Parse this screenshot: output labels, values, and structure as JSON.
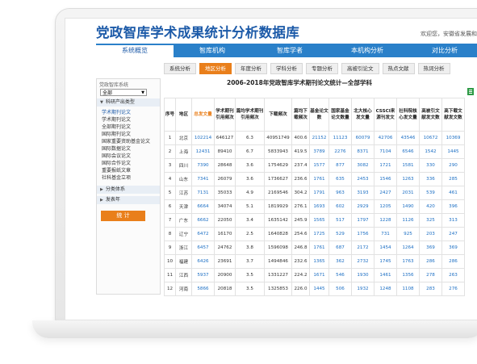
{
  "app": {
    "title": "党政智库学术成果统计分析数据库",
    "welcome": "欢迎您，安徽省发展和改革"
  },
  "nav": {
    "items": [
      {
        "label": "系统概览",
        "active": true
      },
      {
        "label": "智库机构",
        "active": false
      },
      {
        "label": "智库学者",
        "active": false
      },
      {
        "label": "本机构分析",
        "active": false
      },
      {
        "label": "对比分析",
        "active": false
      }
    ]
  },
  "subtabs": [
    {
      "label": "系统分析",
      "active": false
    },
    {
      "label": "地区分析",
      "active": true
    },
    {
      "label": "年度分析",
      "active": false
    },
    {
      "label": "学科分析",
      "active": false
    },
    {
      "label": "专题分析",
      "active": false
    },
    {
      "label": "高被引论文",
      "active": false
    },
    {
      "label": "热点文献",
      "active": false
    },
    {
      "label": "热词分析",
      "active": false
    }
  ],
  "sidebar": {
    "heading": "党政智库系统",
    "select_value": "全部",
    "group1": "科研产出类型",
    "items": [
      "学术期刊论文",
      "学术期刊论文",
      "全部期刊论文",
      "国际期刊论文",
      "国家重要资助基金论文",
      "国际数据论文",
      "国际会议论文",
      "国际合作论文",
      "重要报纸文章",
      "社科基金立项"
    ],
    "group2": "分类体系",
    "group3": "发表年",
    "stat_button": "统 计"
  },
  "table": {
    "title": "2006-2018年党政智库学术期刊论文统计—全部学科",
    "headers": [
      "序号",
      "地区",
      "总发文量",
      "学术期刊引用频次",
      "篇均学术期刊引用频次",
      "下载频次",
      "篇均下载频次",
      "基金论文数",
      "国家基金论文数量",
      "北大核心发文量",
      "CSSCI来源刊发文",
      "社科院核心发文量",
      "高被引文献发文数",
      "高下载文献发文数"
    ],
    "rows": [
      [
        "1",
        "北京",
        "102214",
        "646127",
        "6.3",
        "40951749",
        "400.6",
        "21152",
        "11123",
        "60079",
        "42706",
        "43546",
        "10672",
        "10369"
      ],
      [
        "2",
        "上海",
        "12431",
        "89410",
        "6.7",
        "5833943",
        "419.5",
        "3789",
        "2276",
        "8371",
        "7104",
        "6546",
        "1542",
        "1445"
      ],
      [
        "3",
        "四川",
        "7390",
        "28648",
        "3.6",
        "1754629",
        "237.4",
        "1577",
        "877",
        "3082",
        "1721",
        "1581",
        "330",
        "290"
      ],
      [
        "4",
        "山东",
        "7341",
        "26079",
        "3.6",
        "1736627",
        "236.6",
        "1761",
        "635",
        "2453",
        "1546",
        "1263",
        "336",
        "285"
      ],
      [
        "5",
        "江苏",
        "7131",
        "35033",
        "4.9",
        "2169546",
        "304.2",
        "1791",
        "963",
        "3193",
        "2427",
        "2031",
        "539",
        "461"
      ],
      [
        "6",
        "天津",
        "6664",
        "34074",
        "5.1",
        "1819929",
        "276.1",
        "1693",
        "602",
        "2929",
        "1205",
        "1490",
        "420",
        "396"
      ],
      [
        "7",
        "广东",
        "6662",
        "22050",
        "3.4",
        "1635142",
        "245.9",
        "1565",
        "517",
        "1797",
        "1228",
        "1126",
        "325",
        "313"
      ],
      [
        "8",
        "辽宁",
        "6472",
        "16170",
        "2.5",
        "1640828",
        "254.6",
        "1725",
        "529",
        "1756",
        "731",
        "925",
        "203",
        "247"
      ],
      [
        "9",
        "浙江",
        "6457",
        "24762",
        "3.8",
        "1596098",
        "246.8",
        "1761",
        "687",
        "2172",
        "1454",
        "1264",
        "369",
        "369"
      ],
      [
        "10",
        "福建",
        "6426",
        "23691",
        "3.7",
        "1494846",
        "232.6",
        "1365",
        "362",
        "2732",
        "1745",
        "1763",
        "286",
        "286"
      ],
      [
        "11",
        "江西",
        "5937",
        "20900",
        "3.5",
        "1331227",
        "224.2",
        "1671",
        "546",
        "1930",
        "1461",
        "1356",
        "278",
        "263"
      ],
      [
        "12",
        "河南",
        "5866",
        "20818",
        "3.5",
        "1325853",
        "226.0",
        "1445",
        "506",
        "1932",
        "1248",
        "1108",
        "283",
        "276"
      ]
    ]
  }
}
